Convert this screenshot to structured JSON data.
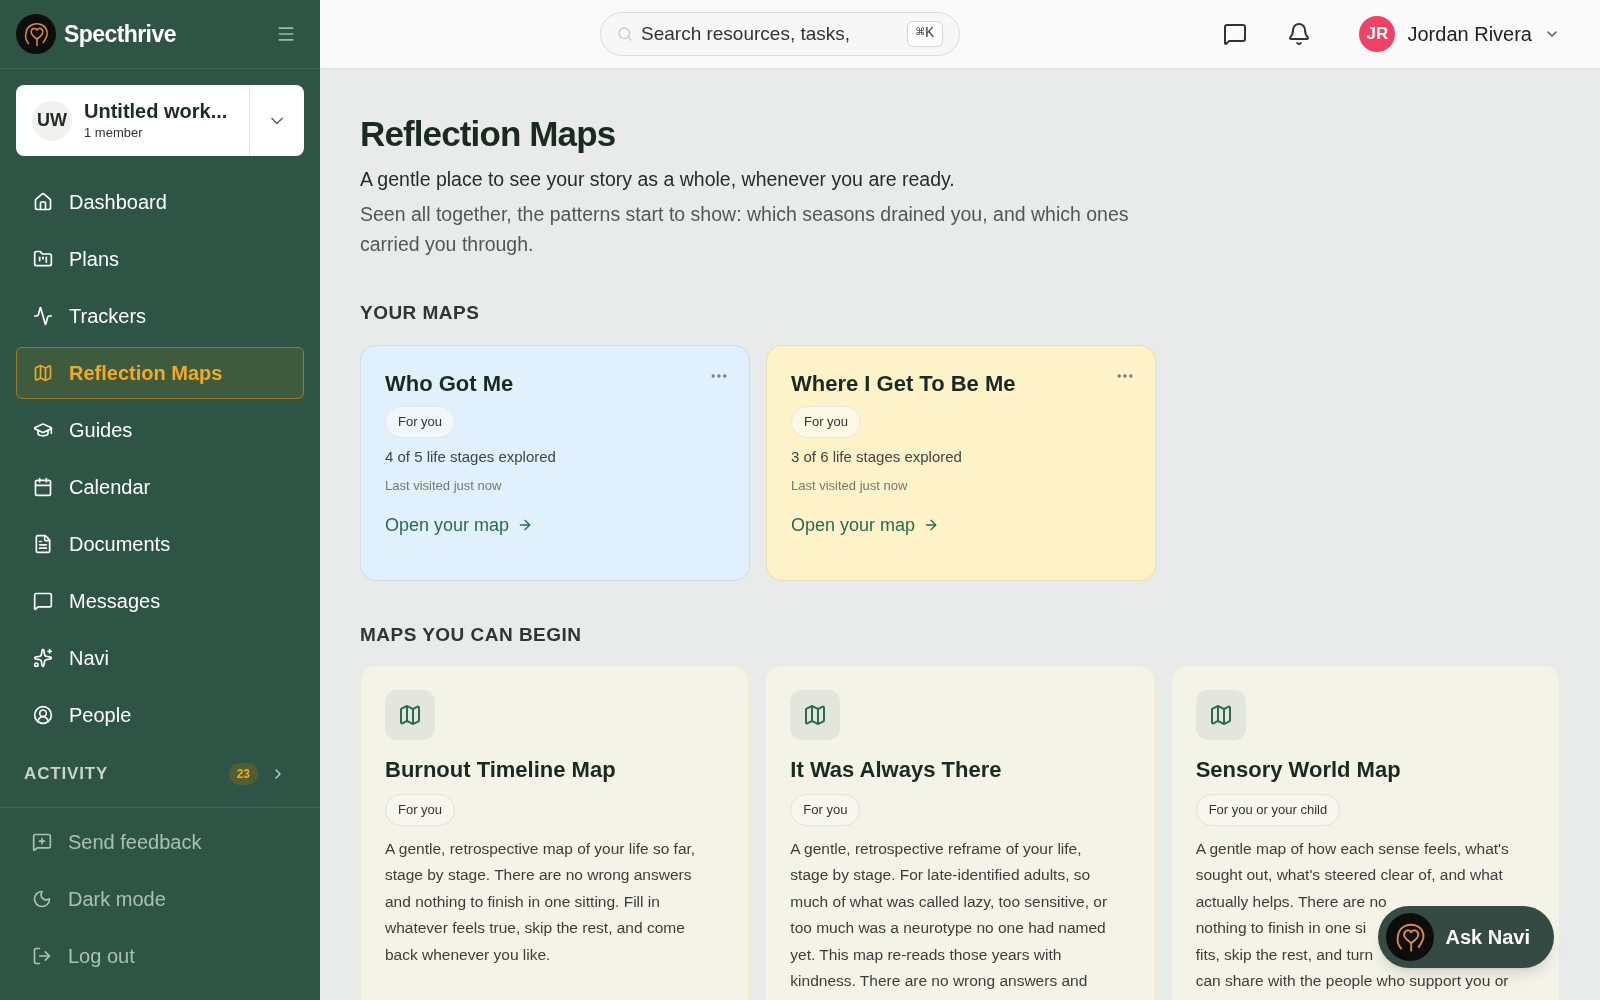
{
  "brand": {
    "name": "Specthrive"
  },
  "workspace": {
    "initials": "UW",
    "name": "Untitled work...",
    "members": "1 member"
  },
  "nav": [
    {
      "label": "Dashboard",
      "selected": false
    },
    {
      "label": "Plans",
      "selected": false
    },
    {
      "label": "Trackers",
      "selected": false
    },
    {
      "label": "Reflection Maps",
      "selected": true
    },
    {
      "label": "Guides",
      "selected": false
    },
    {
      "label": "Calendar",
      "selected": false
    },
    {
      "label": "Documents",
      "selected": false
    },
    {
      "label": "Messages",
      "selected": false
    },
    {
      "label": "Navi",
      "selected": false
    },
    {
      "label": "People",
      "selected": false
    }
  ],
  "activity": {
    "label": "ACTIVITY",
    "count": "23"
  },
  "footer_items": [
    {
      "label": "Send feedback"
    },
    {
      "label": "Dark mode"
    },
    {
      "label": "Log out"
    }
  ],
  "header": {
    "search_placeholder": "Search resources, tasks,",
    "shortcut": "⌘K",
    "user": {
      "initials": "JR",
      "name": "Jordan Rivera"
    }
  },
  "page": {
    "title": "Reflection Maps",
    "subtitle": "A gentle place to see your story as a whole, whenever you are ready.",
    "intro": "Seen all together, the patterns start to show: which seasons drained you, and which ones carried you through."
  },
  "your_maps": {
    "heading": "YOUR MAPS",
    "items": [
      {
        "title": "Who Got Me",
        "tag": "For you",
        "progress": "4 of 5 life stages explored",
        "visited": "Last visited just now",
        "link": "Open your map",
        "color": "#e0f0fd"
      },
      {
        "title": "Where I Get To Be Me",
        "tag": "For you",
        "progress": "3 of 6 life stages explored",
        "visited": "Last visited just now",
        "link": "Open your map",
        "color": "#fdf2c8"
      }
    ]
  },
  "begin_maps": {
    "heading": "MAPS YOU CAN BEGIN",
    "items": [
      {
        "title": "Burnout Timeline Map",
        "tag": "For you",
        "description_lines": [
          "A gentle, retrospective map of your life so far,",
          "stage by stage. There are no wrong answers",
          "and nothing to finish in one sitting. Fill in",
          "whatever feels true, skip the rest, and come",
          "back whenever you like."
        ]
      },
      {
        "title": "It Was Always There",
        "tag": "For you",
        "description_lines": [
          "A gentle, retrospective reframe of your life,",
          "stage by stage. For late-identified adults, so",
          "much of what was called lazy, too sensitive, or",
          "too much was a neurotype no one had named",
          "yet. This map re-reads those years with",
          "kindness. There are no wrong answers and"
        ]
      },
      {
        "title": "Sensory World Map",
        "tag": "For you or your child",
        "description_lines": [
          "A gentle map of how each sense feels, what's",
          "sought out, what's steered clear of, and what",
          "actually helps. There are no",
          "nothing to finish in one si",
          "fits, skip the rest, and turn",
          "can share with the people who support you or"
        ]
      }
    ]
  },
  "assistant_button": {
    "label": "Ask Navi"
  }
}
